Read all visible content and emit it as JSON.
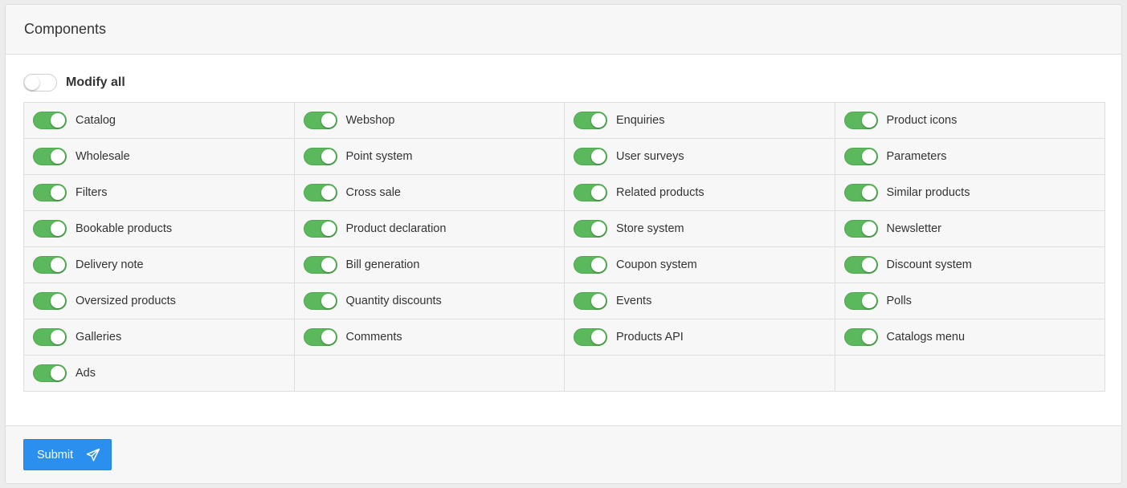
{
  "panel": {
    "title": "Components"
  },
  "modify_all": {
    "label": "Modify all",
    "checked": false
  },
  "components": [
    {
      "label": "Catalog",
      "checked": true
    },
    {
      "label": "Webshop",
      "checked": true
    },
    {
      "label": "Enquiries",
      "checked": true
    },
    {
      "label": "Product icons",
      "checked": true
    },
    {
      "label": "Wholesale",
      "checked": true
    },
    {
      "label": "Point system",
      "checked": true
    },
    {
      "label": "User surveys",
      "checked": true
    },
    {
      "label": "Parameters",
      "checked": true
    },
    {
      "label": "Filters",
      "checked": true
    },
    {
      "label": "Cross sale",
      "checked": true
    },
    {
      "label": "Related products",
      "checked": true
    },
    {
      "label": "Similar products",
      "checked": true
    },
    {
      "label": "Bookable products",
      "checked": true
    },
    {
      "label": "Product declaration",
      "checked": true
    },
    {
      "label": "Store system",
      "checked": true
    },
    {
      "label": "Newsletter",
      "checked": true
    },
    {
      "label": "Delivery note",
      "checked": true
    },
    {
      "label": "Bill generation",
      "checked": true
    },
    {
      "label": "Coupon system",
      "checked": true
    },
    {
      "label": "Discount system",
      "checked": true
    },
    {
      "label": "Oversized products",
      "checked": true
    },
    {
      "label": "Quantity discounts",
      "checked": true
    },
    {
      "label": "Events",
      "checked": true
    },
    {
      "label": "Polls",
      "checked": true
    },
    {
      "label": "Galleries",
      "checked": true
    },
    {
      "label": "Comments",
      "checked": true
    },
    {
      "label": "Products API",
      "checked": true
    },
    {
      "label": "Catalogs menu",
      "checked": true
    },
    {
      "label": "Ads",
      "checked": true
    }
  ],
  "footer": {
    "submit_label": "Submit",
    "submit_icon": "paper-plane-icon"
  },
  "colors": {
    "accent": "#2b8ff0",
    "toggle_on": "#5cb85c",
    "cell_bg": "#f7f7f7"
  }
}
